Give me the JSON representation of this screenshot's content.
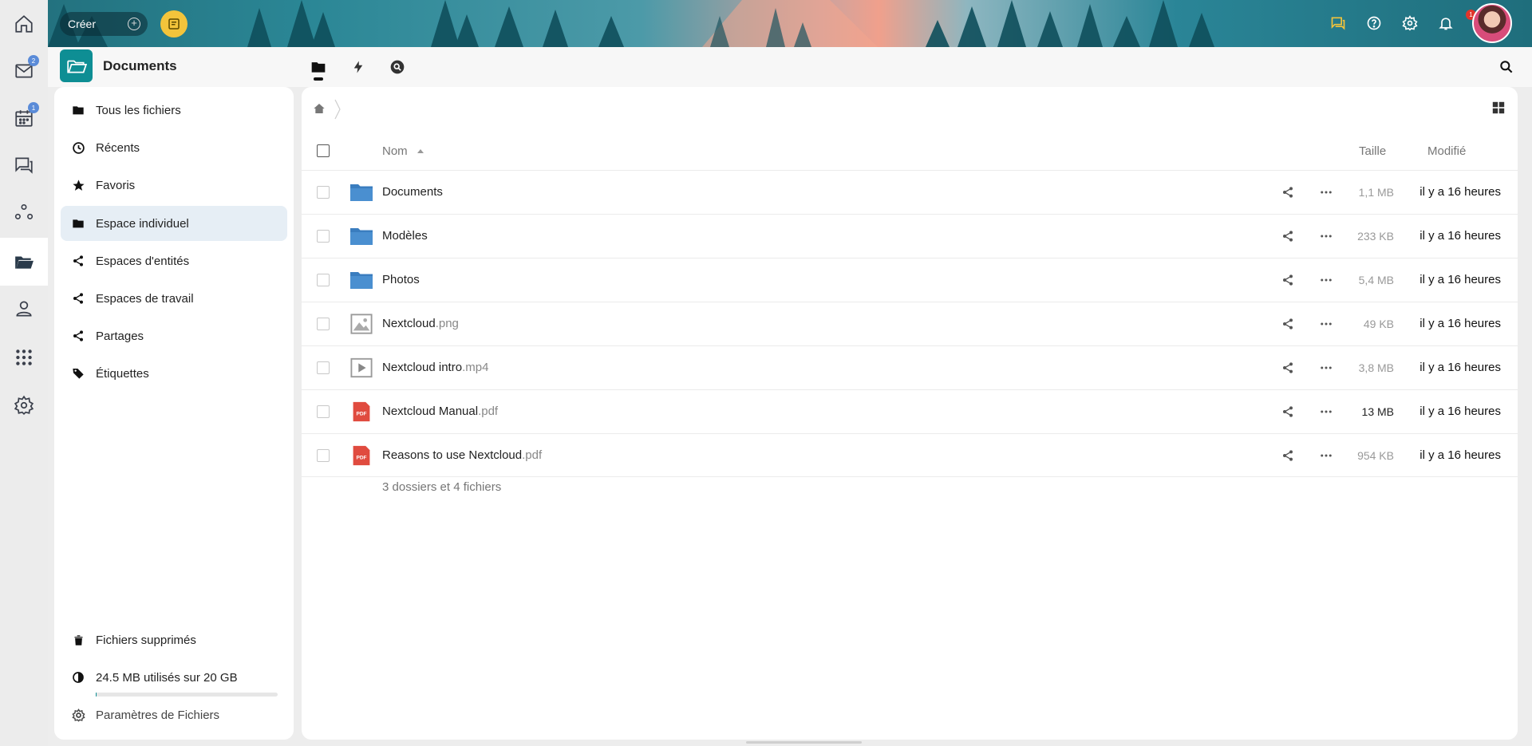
{
  "header": {
    "create_label": "Créer",
    "notifications_count": "1"
  },
  "rail": {
    "mail_badge": "2",
    "calendar_badge": "1"
  },
  "app": {
    "title": "Documents"
  },
  "sidebar": {
    "items": [
      {
        "label": "Tous les fichiers",
        "icon": "folder-icon"
      },
      {
        "label": "Récents",
        "icon": "clock-icon"
      },
      {
        "label": "Favoris",
        "icon": "star-icon"
      },
      {
        "label": "Espace individuel",
        "icon": "folder-icon"
      },
      {
        "label": "Espaces d'entités",
        "icon": "share-icon"
      },
      {
        "label": "Espaces de travail",
        "icon": "share-icon"
      },
      {
        "label": "Partages",
        "icon": "share-icon"
      },
      {
        "label": "Étiquettes",
        "icon": "tag-icon"
      }
    ],
    "trash_label": "Fichiers supprimés",
    "quota_label": "24.5 MB utilisés sur 20 GB",
    "quota_fraction": 0.0012,
    "settings_label": "Paramètres de Fichiers"
  },
  "table": {
    "col_name": "Nom",
    "col_size": "Taille",
    "col_modified": "Modifié",
    "rows": [
      {
        "name": "Documents",
        "ext": "",
        "type": "folder",
        "size": "1,1 MB",
        "modified": "il y a 16 heures"
      },
      {
        "name": "Modèles",
        "ext": "",
        "type": "folder",
        "size": "233 KB",
        "modified": "il y a 16 heures"
      },
      {
        "name": "Photos",
        "ext": "",
        "type": "folder",
        "size": "5,4 MB",
        "modified": "il y a 16 heures"
      },
      {
        "name": "Nextcloud",
        "ext": ".png",
        "type": "image",
        "size": "49 KB",
        "modified": "il y a 16 heures"
      },
      {
        "name": "Nextcloud intro",
        "ext": ".mp4",
        "type": "video",
        "size": "3,8 MB",
        "modified": "il y a 16 heures"
      },
      {
        "name": "Nextcloud Manual",
        "ext": ".pdf",
        "type": "pdf",
        "size": "13 MB",
        "modified": "il y a 16 heures"
      },
      {
        "name": "Reasons to use Nextcloud",
        "ext": ".pdf",
        "type": "pdf",
        "size": "954 KB",
        "modified": "il y a 16 heures"
      }
    ],
    "summary": "3 dossiers et 4 fichiers"
  },
  "colors": {
    "accent": "#0e8e94",
    "folder": "#3a7dbf",
    "pdf": "#e04b3f",
    "active_nav": "#e6eef5"
  }
}
